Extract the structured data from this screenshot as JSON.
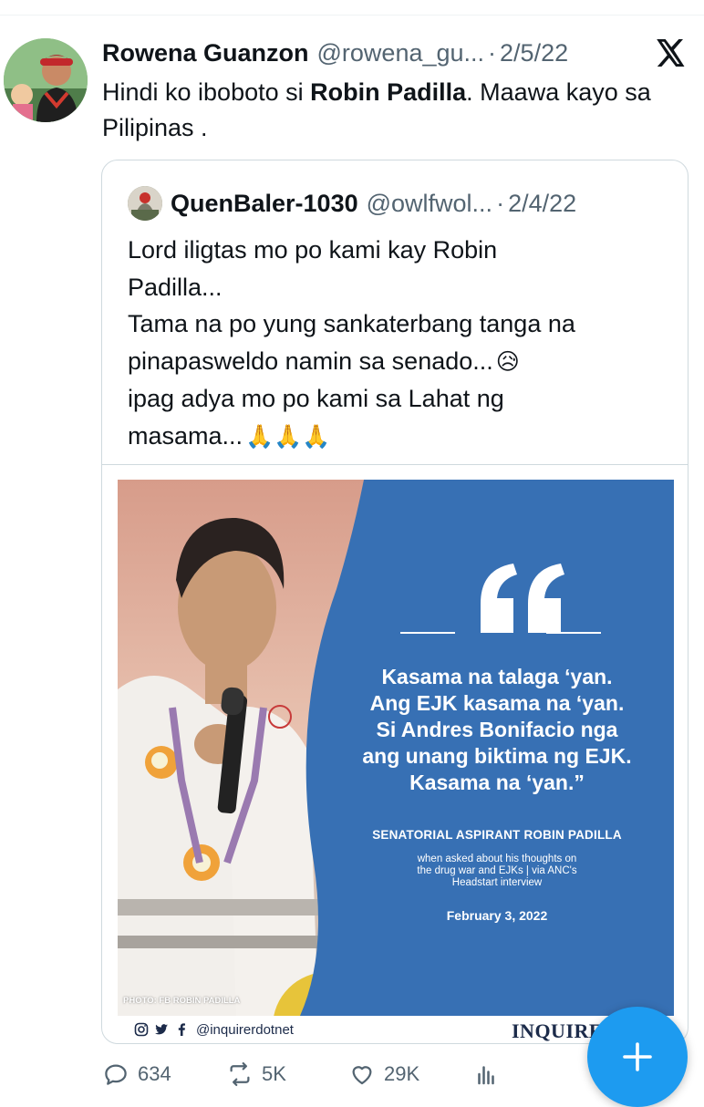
{
  "tweet": {
    "author_name": "Rowena Guanzon",
    "author_handle": "@rowena_gu...",
    "separator": "·",
    "date": "2/5/22",
    "text_before": "Hindi ko iboboto si ",
    "text_bold": "Robin Padilla",
    "text_after": ". Maawa kayo sa Pilipinas .",
    "platform_icon": "x-logo-icon"
  },
  "quoted_tweet": {
    "author_name": "QuenBaler-1030",
    "author_handle": "@owlfwol...",
    "separator": "·",
    "date": "2/4/22",
    "lines": [
      "Lord iligtas mo po kami kay Robin",
      "Padilla...",
      "Tama na po yung sankaterbang tanga na",
      "pinapasweldo namin sa senado...",
      "ipag adya mo po kami sa Lahat ng",
      "masama..."
    ],
    "emoji_sad": "😥",
    "emoji_pray": "🙏🙏🙏",
    "infographic": {
      "quote_lines": [
        "Kasama na talaga ‘yan.",
        "Ang EJK kasama na ‘yan.",
        "Si Andres Bonifacio nga",
        "ang unang biktima ng EJK.",
        "Kasama na ‘yan.”"
      ],
      "attribution": "SENATORIAL ASPIRANT ROBIN PADILLA",
      "note_lines": [
        "when asked about his thoughts on",
        "the drug war and EJKs | via ANC's",
        "Headstart interview"
      ],
      "date": "February 3, 2022",
      "photo_credit": "PHOTO: FB ROBIN PADILLA",
      "social_handle": "@inquirerdotnet",
      "brand": "INQUIRE",
      "panel_color": "#3770b4"
    }
  },
  "actions": {
    "replies": "634",
    "retweets": "5K",
    "likes": "29K"
  },
  "colors": {
    "accent": "#1d9bf0",
    "text_primary": "#0f1419",
    "text_secondary": "#536471",
    "border": "#cfd9de"
  }
}
